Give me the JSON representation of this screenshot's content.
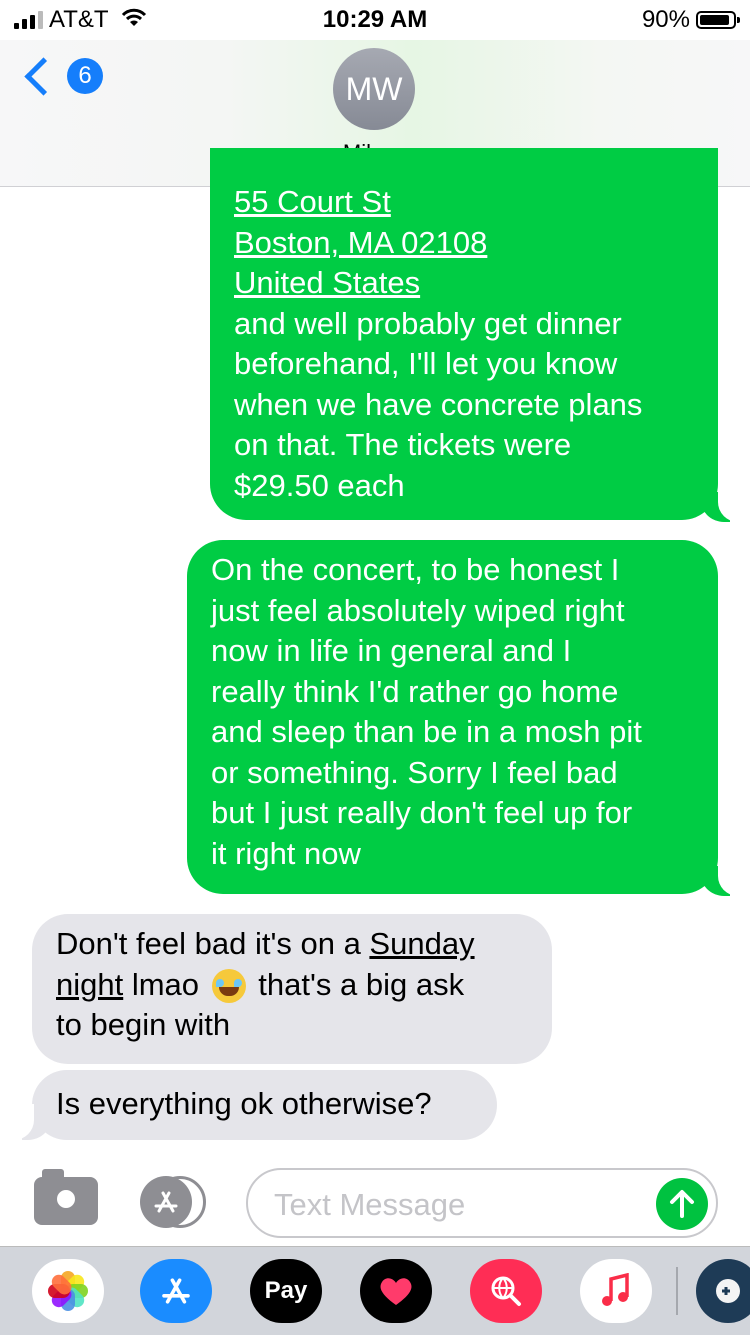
{
  "status_bar": {
    "carrier": "AT&T",
    "time": "10:29 AM",
    "battery_percent": "90%",
    "battery_level": 0.9,
    "signal_bars": 3
  },
  "header": {
    "back_count": "6",
    "avatar_initials": "MW",
    "contact_name": "Mike",
    "contact_chevron": ">"
  },
  "messages": [
    {
      "from": "me",
      "lines": [
        {
          "text": "55 Court St",
          "link": true
        },
        {
          "text": "Boston, MA  02108",
          "link": true
        },
        {
          "text": "United States",
          "link": true
        },
        {
          "text": "and well probably get dinner",
          "link": false
        },
        {
          "text": "beforehand, I'll let you know",
          "link": false
        },
        {
          "text": "when we have concrete plans",
          "link": false
        },
        {
          "text": "on that. The tickets were",
          "link": false
        },
        {
          "text": "$29.50 each",
          "link": false
        }
      ]
    },
    {
      "from": "me",
      "lines": [
        {
          "text": "On the concert, to be honest I"
        },
        {
          "text": "just feel absolutely wiped right"
        },
        {
          "text": "now in life in general and I"
        },
        {
          "text": "really think I'd rather go home"
        },
        {
          "text": "and sleep than be in a mosh pit"
        },
        {
          "text": "or something. Sorry I feel bad"
        },
        {
          "text": "but I just really don't feel up for"
        },
        {
          "text": "it right now"
        }
      ]
    },
    {
      "from": "them",
      "line1_pre": "Don't feel bad it's on a ",
      "line1_link": "Sunday",
      "line2_link": "night",
      "line2_post_a": " lmao ",
      "emoji": "😂",
      "line2_post_b": " that's a big ask",
      "line3": "to begin with"
    },
    {
      "from": "them",
      "text": "Is everything ok otherwise?"
    }
  ],
  "input": {
    "placeholder": "Text Message",
    "value": ""
  },
  "icons": {
    "camera": "camera-icon",
    "apps": "app-store-icon",
    "send": "send-arrow-icon"
  },
  "drawer": {
    "apps": [
      "Photos",
      "App Store",
      "Pay",
      "Digital Touch",
      "Search",
      "Music",
      "Game"
    ],
    "pay_label": "Pay",
    "apple_glyph": ""
  },
  "colors": {
    "sent_bubble": "#00cc44",
    "received_bubble": "#e5e5ea",
    "ios_blue": "#157efb"
  }
}
